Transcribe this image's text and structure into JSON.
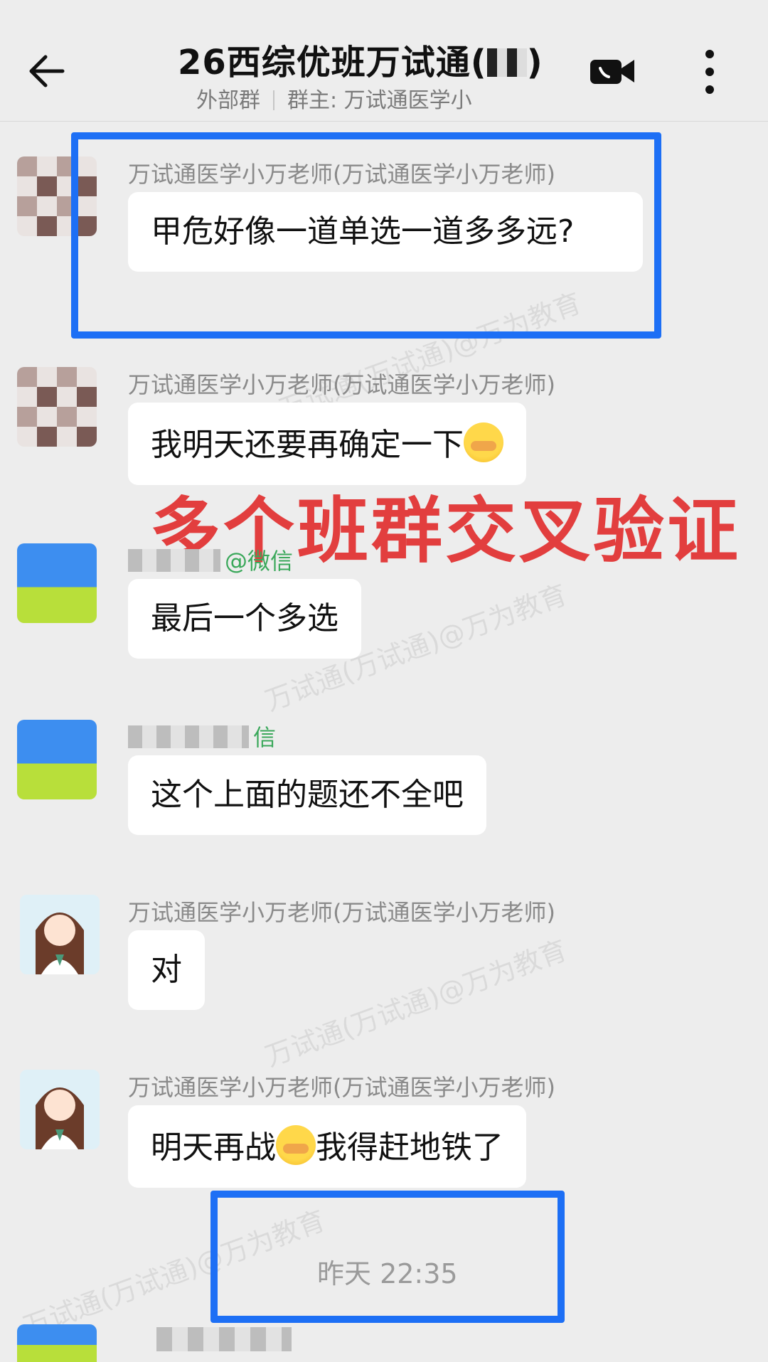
{
  "header": {
    "title": "26西综优班万试通(",
    "external_label": "外部群",
    "owner_label": "群主: 万试通医学小"
  },
  "icons": {
    "back": "arrow-left-icon",
    "video": "video-call-icon",
    "more": "more-vertical-icon"
  },
  "messages": [
    {
      "sender": "万试通医学小万老师(万试通医学小万老师)",
      "text": "甲危好像一道单选一道多多远?"
    },
    {
      "sender": "万试通医学小万老师(万试通医学小万老师)",
      "text": "我明天还要再确定一下"
    },
    {
      "sender": "@微信",
      "text": "最后一个多选"
    },
    {
      "sender": "信",
      "text": "这个上面的题还不全吧"
    },
    {
      "sender": "万试通医学小万老师(万试通医学小万老师)",
      "text": "对"
    },
    {
      "sender": "万试通医学小万老师(万试通医学小万老师)",
      "text_before": "明天再战",
      "text_after": "我得赶地铁了"
    }
  ],
  "overlay_caption": "多个班群交叉验证",
  "timestamp": "昨天  22:35",
  "watermark": "万试通(万试通)@万为教育",
  "colors": {
    "background": "#ededed",
    "highlight_border": "#1d6ff5",
    "overlay_red": "#e23e3e",
    "wechat_green": "#3aa85a"
  }
}
